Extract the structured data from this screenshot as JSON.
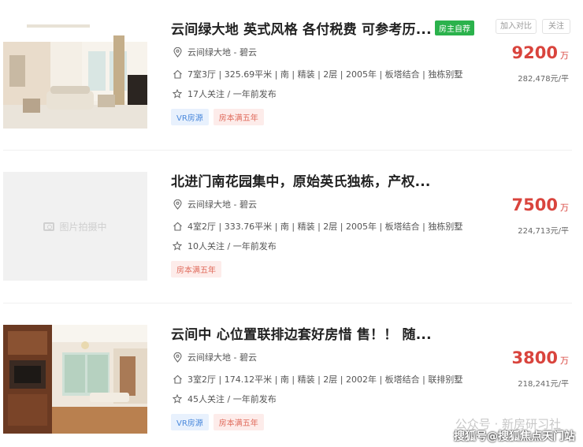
{
  "listings": [
    {
      "title": "云间绿大地 英式风格 各付税费 可参考历...",
      "owner_badge": "房主自荐",
      "compare_label": "加入对比",
      "follow_label": "关注",
      "location": "云间绿大地 - 碧云",
      "info": "7室3厅 | 325.69平米 | 南 | 精装 | 2层 | 2005年 | 板塔结合 | 独栋别墅",
      "follow_info": "17人关注 / 一年前发布",
      "tags": [
        "VR房源",
        "房本满五年"
      ],
      "price": "9200",
      "price_unit": "万",
      "unit_price": "282,478元/平",
      "photo": "living-room-photo"
    },
    {
      "title": "北进门南花园集中，原始英氏独栋，产权...",
      "location": "云间绿大地 - 碧云",
      "info": "4室2厅 | 333.76平米 | 南 | 精装 | 2层 | 2005年 | 板塔结合 | 独栋别墅",
      "follow_info": "10人关注 / 一年前发布",
      "tags": [
        "房本满五年"
      ],
      "price": "7500",
      "price_unit": "万",
      "unit_price": "224,713元/平",
      "photo_placeholder": "图片拍摄中"
    },
    {
      "title": "云间中 心位置联排边套好房惜 售！！ 随...",
      "location": "云间绿大地 - 碧云",
      "info": "3室2厅 | 174.12平米 | 南 | 精装 | 2层 | 2002年 | 板塔结合 | 联排别墅",
      "follow_info": "45人关注 / 一年前发布",
      "tags": [
        "VR房源",
        "房本满五年"
      ],
      "price": "3800",
      "price_unit": "万",
      "unit_price": "218,241元/平",
      "photo": "wood-interior-photo"
    }
  ],
  "watermarks": {
    "line1": "公众号 · 新房研习社",
    "line2": "搜狐号@搜狐焦点天门站"
  },
  "colors": {
    "price": "#d9443d",
    "owner_badge": "#2bb24c",
    "vr_tag": "#4b89dc",
    "deed_tag": "#e06b5c"
  }
}
